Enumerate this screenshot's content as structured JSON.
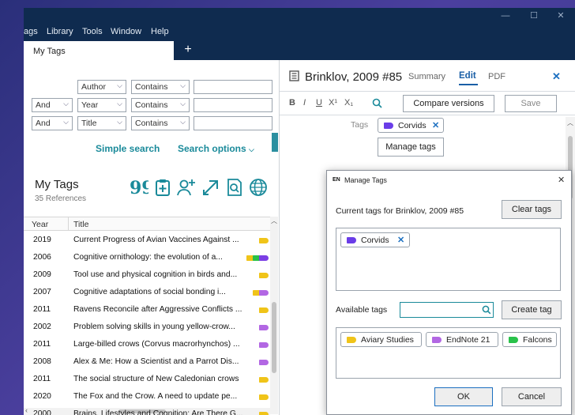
{
  "menu": [
    "ags",
    "Library",
    "Tools",
    "Window",
    "Help"
  ],
  "tabs": {
    "active": "My Tags",
    "add": "+"
  },
  "search": {
    "rows": [
      {
        "bool": "",
        "field": "Author",
        "op": "Contains"
      },
      {
        "bool": "And",
        "field": "Year",
        "op": "Contains"
      },
      {
        "bool": "And",
        "field": "Title",
        "op": "Contains"
      }
    ],
    "simple": "Simple search",
    "options": "Search options"
  },
  "library": {
    "title": "My Tags",
    "count": "35 References",
    "columns": {
      "year": "Year",
      "title": "Title"
    },
    "rows": [
      {
        "year": "2019",
        "title": "Current Progress of Avian Vaccines Against ...",
        "tags": [
          "#f0c419"
        ]
      },
      {
        "year": "2006",
        "title": "Cognitive ornithology: the evolution of a...",
        "tags": [
          "#f0c419",
          "#29c24a",
          "#7b3fe4"
        ]
      },
      {
        "year": "2009",
        "title": "Tool use and physical cognition in birds and...",
        "tags": [
          "#f0c419"
        ]
      },
      {
        "year": "2007",
        "title": "Cognitive adaptations of social bonding i...",
        "tags": [
          "#f0c419",
          "#b267e3"
        ]
      },
      {
        "year": "2011",
        "title": "Ravens Reconcile after Aggressive Conflicts ...",
        "tags": [
          "#f0c419"
        ]
      },
      {
        "year": "2002",
        "title": "Problem solving skills in young yellow-crow...",
        "tags": [
          "#b267e3"
        ]
      },
      {
        "year": "2011",
        "title": "Large-billed crows (Corvus macrorhynchos) ...",
        "tags": [
          "#b267e3"
        ]
      },
      {
        "year": "2008",
        "title": "Alex & Me: How a Scientist and a Parrot Dis...",
        "tags": [
          "#b267e3"
        ]
      },
      {
        "year": "2011",
        "title": "The social structure of New Caledonian crows",
        "tags": [
          "#f0c419"
        ]
      },
      {
        "year": "2020",
        "title": "The Fox and the Crow. A need to update pe...",
        "tags": [
          "#f0c419"
        ]
      },
      {
        "year": "2000",
        "title": "Brains, Lifestyles and Cognition: Are There G...",
        "tags": [
          "#f0c419"
        ]
      }
    ]
  },
  "reference": {
    "title": "Brinklov, 2009 #85",
    "tabs": {
      "summary": "Summary",
      "edit": "Edit",
      "pdf": "PDF"
    },
    "close": "✕",
    "format": {
      "bold": "B",
      "italic": "I",
      "underline": "U",
      "sup": "X¹",
      "sub": "X₁"
    },
    "compare": "Compare versions",
    "save": "Save",
    "tags_label": "Tags",
    "tag": "Corvids",
    "manage": "Manage tags"
  },
  "dialog": {
    "title": "Manage Tags",
    "app_mark": "EN",
    "close": "✕",
    "current_label": "Current tags for Brinklov, 2009 #85",
    "clear": "Clear tags",
    "current_tags": [
      {
        "name": "Corvids",
        "color": "#6a3de8"
      }
    ],
    "available_label": "Available tags",
    "search_value": "",
    "create": "Create tag",
    "available_tags": [
      {
        "name": "Aviary Studies",
        "color": "#f0c419"
      },
      {
        "name": "EndNote 21",
        "color": "#b267e3"
      },
      {
        "name": "Falcons",
        "color": "#29c24a"
      }
    ],
    "ok": "OK",
    "cancel": "Cancel"
  },
  "colors": {
    "navy": "#0f2b4f",
    "teal": "#1a8a9a",
    "accent": "#1b6fc0"
  }
}
